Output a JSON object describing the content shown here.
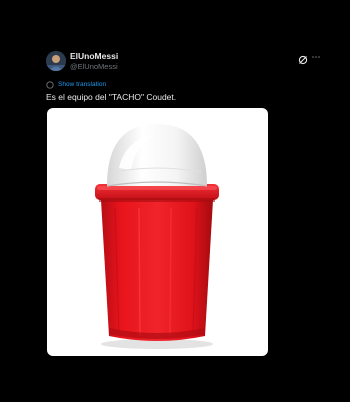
{
  "author": {
    "display_name": "ElUnoMessi",
    "handle": "@ElUnoMessi",
    "avatar_icon": "user-avatar"
  },
  "header_icons": {
    "grok": "grok-icon",
    "more": "more-icon"
  },
  "translate": {
    "icon": "globe-icon",
    "label": "Show translation"
  },
  "tweet": {
    "text": "Es el equipo del \"TACHO\" Coudet."
  },
  "media": {
    "subject": "red-trash-bin-with-white-lid",
    "colors": {
      "bin": "#e8141c",
      "lid": "#f2f2f2",
      "background": "#ffffff"
    }
  },
  "colors": {
    "background": "#000000",
    "text_primary": "#e7e9ea",
    "text_secondary": "#71767b",
    "link": "#1d9bf0"
  }
}
